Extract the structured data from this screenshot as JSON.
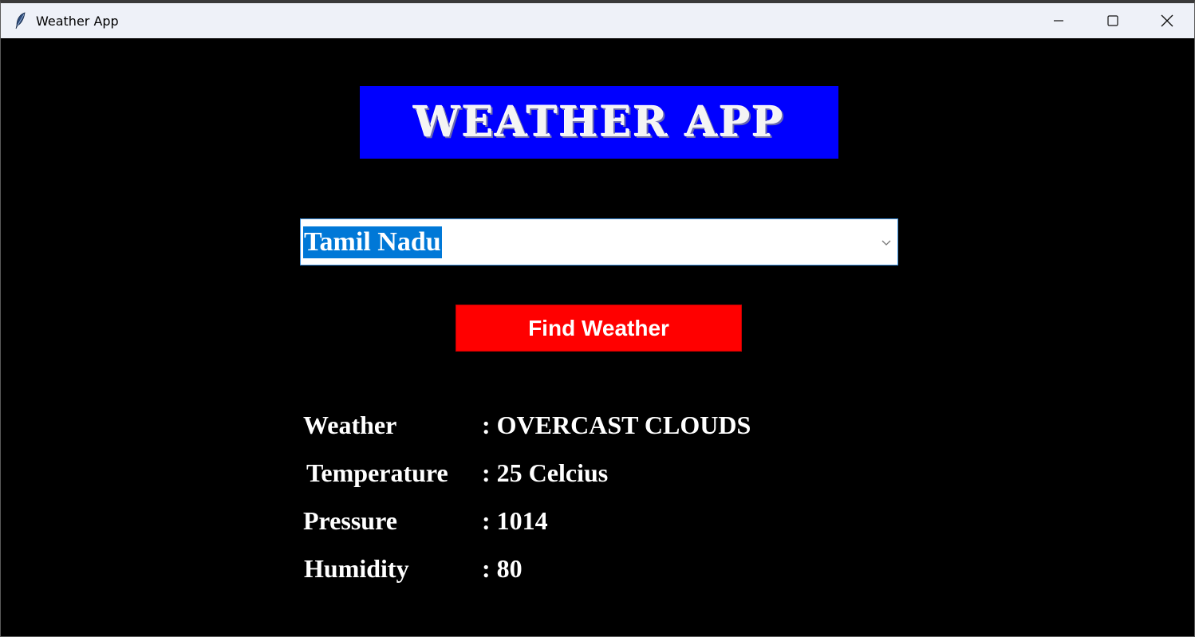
{
  "window": {
    "title": "Weather App",
    "icon": "feather-icon",
    "controls": [
      "minimize-icon",
      "maximize-icon",
      "close-icon"
    ]
  },
  "banner": {
    "text": "WEATHER APP",
    "background": "#0000ff"
  },
  "location_select": {
    "selected": "Tamil Nadu"
  },
  "find_button": {
    "label": "Find Weather",
    "background": "#ff0000"
  },
  "results": {
    "weather": {
      "label": "Weather",
      "value": ": OVERCAST CLOUDS"
    },
    "temperature": {
      "label": "Temperature",
      "value": ": 25 Celcius"
    },
    "pressure": {
      "label": "Pressure",
      "value": ": 1014"
    },
    "humidity": {
      "label": "Humidity",
      "value": ": 80"
    }
  }
}
